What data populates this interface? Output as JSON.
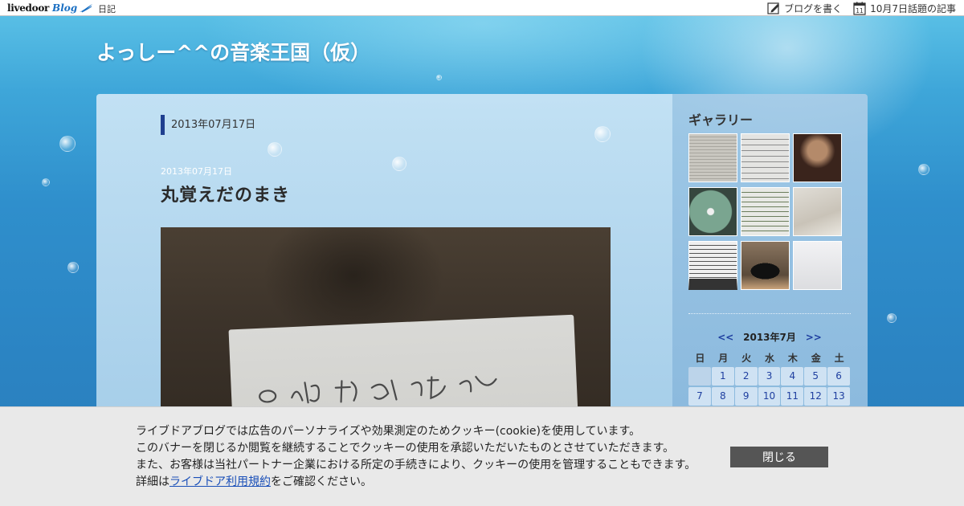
{
  "topbar": {
    "logo_livedoor": "livedoor",
    "logo_blog": "Blog",
    "diary_link": "日記",
    "write_blog": "ブログを書く",
    "calendar_icon_day": "11",
    "topic_link": "10月7日話題の記事"
  },
  "blog": {
    "title": "よっしー^^の音楽王国（仮）"
  },
  "main": {
    "date_heading": "2013年07月17日",
    "post": {
      "date": "2013年07月17日",
      "title": "丸覚えだのまき"
    }
  },
  "sidebar": {
    "gallery_title": "ギャラリー",
    "thumbnails": [
      {
        "name": "newspaper",
        "color": "#b9b7b0"
      },
      {
        "name": "schedule-sheet",
        "color": "#c8cac8"
      },
      {
        "name": "concert-poster",
        "color": "#4a3026"
      },
      {
        "name": "bach-cd",
        "color": "#8aa99a"
      },
      {
        "name": "program-sheet",
        "color": "#d9dad6"
      },
      {
        "name": "venue-photo",
        "color": "#cfcbc4"
      },
      {
        "name": "music-score",
        "color": "#dcdcdc"
      },
      {
        "name": "piano-stage",
        "color": "#6a5846"
      },
      {
        "name": "document",
        "color": "#e8e8ea"
      }
    ],
    "calendar": {
      "prev": "<<",
      "month": "2013年7月",
      "next": ">>",
      "weekdays": [
        "日",
        "月",
        "火",
        "水",
        "木",
        "金",
        "土"
      ],
      "weeks": [
        [
          "",
          "1",
          "2",
          "3",
          "4",
          "5",
          "6"
        ],
        [
          "7",
          "8",
          "9",
          "10",
          "11",
          "12",
          "13"
        ]
      ]
    }
  },
  "cookie": {
    "line1": "ライブドアブログでは広告のパーソナライズや効果測定のためクッキー(cookie)を使用しています。",
    "line2": "このバナーを閉じるか閲覧を継続することでクッキーの使用を承認いただいたものとさせていただきます。",
    "line3": "また、お客様は当社パートナー企業における所定の手続きにより、クッキーの使用を管理することもできます。",
    "line4_prefix": "詳細は",
    "line4_link": "ライブドア利用規約",
    "line4_suffix": "をご確認ください。",
    "close_button": "閉じる"
  }
}
